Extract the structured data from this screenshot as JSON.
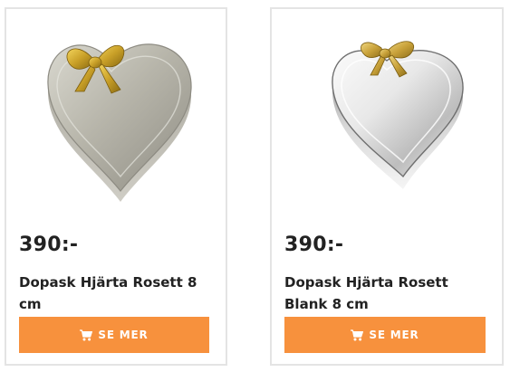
{
  "accent_color": "#f7913d",
  "products": [
    {
      "price": "390:-",
      "name": "Dopask Hjärta Rosett 8 cm",
      "button_label": "SE MER",
      "button_icon": "cart-icon",
      "image_desc": "brushed-silver-heart-box-gold-bow"
    },
    {
      "price": "390:-",
      "name": "Dopask Hjärta Rosett Blank 8 cm",
      "button_label": "SE MER",
      "button_icon": "cart-icon",
      "image_desc": "polished-silver-heart-box-gold-bow"
    }
  ]
}
